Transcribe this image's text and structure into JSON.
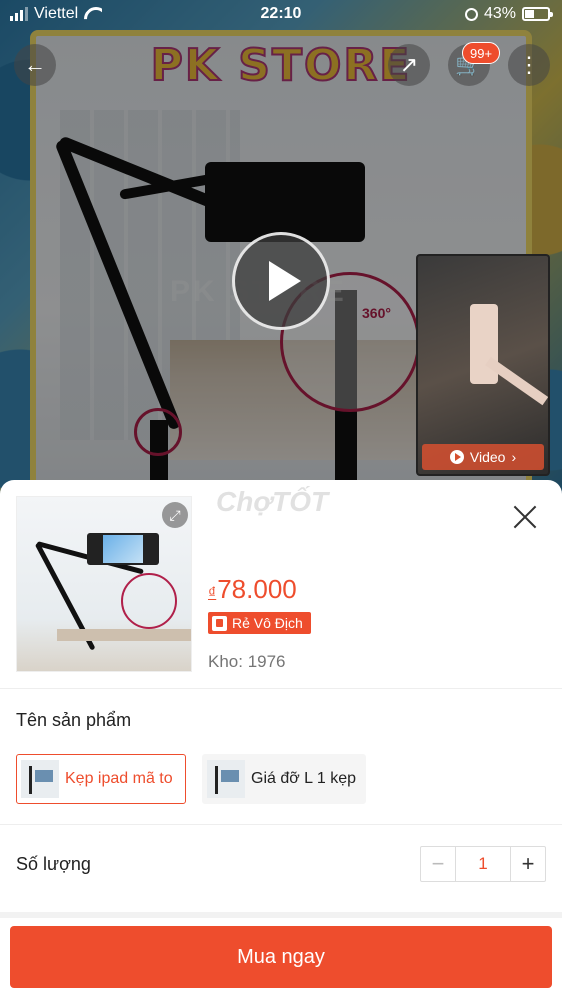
{
  "status_bar": {
    "carrier": "Viettel",
    "time": "22:10",
    "battery": "43%",
    "battery_level": 0.43
  },
  "hero": {
    "store_banner": "PK STORE",
    "spec_label": "360°",
    "watermark": "PK STORE",
    "cart_badge": "99+",
    "video_label": "Video"
  },
  "icons": {
    "back": "back-arrow-icon",
    "share": "share-icon",
    "cart": "cart-icon",
    "more": "more-icon",
    "play": "play-icon",
    "expand": "expand-icon",
    "close": "close-icon"
  },
  "sheet": {
    "price_currency": "₫",
    "price": "78.000",
    "deal_badge": "Rẻ Vô Địch",
    "stock": "Kho: 1976",
    "watermark": "ChợTỐT",
    "variant_section_label": "Tên sản phẩm",
    "variants": [
      {
        "label": "Kẹp ipad mã to",
        "selected": true
      },
      {
        "label": "Giá đỡ L 1 kẹp",
        "selected": false
      }
    ],
    "quantity_label": "Số lượng",
    "quantity": "1",
    "minus": "−",
    "plus": "+",
    "buy_button": "Mua ngay"
  },
  "colors": {
    "accent": "#ee4d2d",
    "store_banner": "#f2c13b"
  }
}
